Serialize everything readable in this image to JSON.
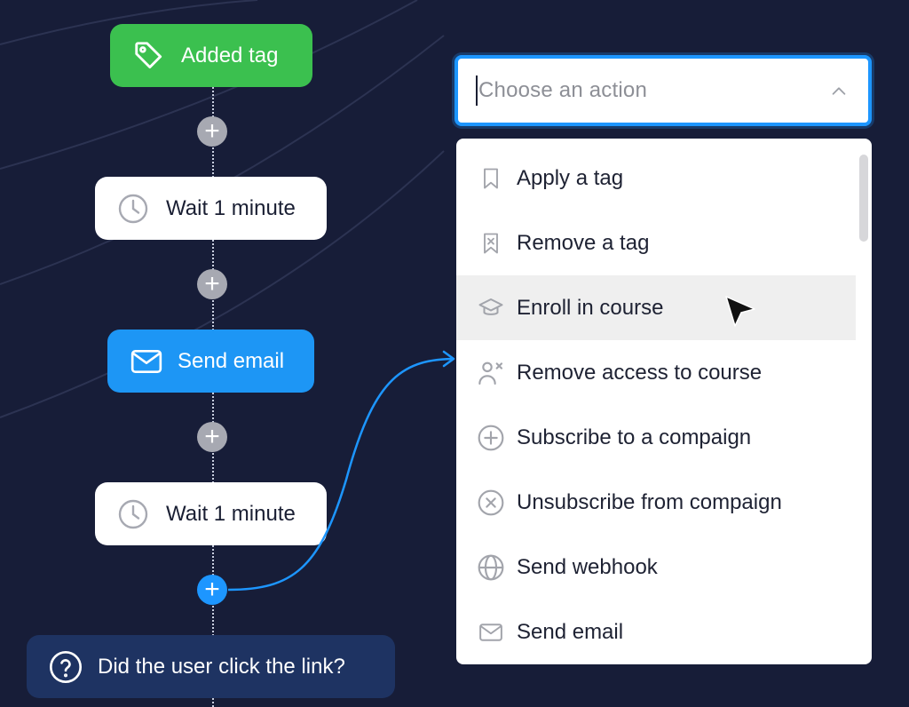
{
  "flow": {
    "trigger": {
      "label": "Added tag",
      "icon": "tag-icon"
    },
    "step1": {
      "label": "Wait 1 minute",
      "icon": "clock-icon"
    },
    "step2": {
      "label": "Send email",
      "icon": "mail-icon"
    },
    "step3": {
      "label": "Wait 1 minute",
      "icon": "clock-icon"
    },
    "condition": {
      "label": "Did the user click the link?",
      "icon": "question-circle-icon"
    },
    "add_symbol": "+"
  },
  "action_select": {
    "placeholder": "Choose an action",
    "chevron": "chevron-up-icon"
  },
  "menu": {
    "items": [
      {
        "label": "Apply a tag",
        "icon": "bookmark-icon"
      },
      {
        "label": "Remove a tag",
        "icon": "bookmark-x-icon"
      },
      {
        "label": "Enroll in course",
        "icon": "graduation-cap-icon",
        "hovered": true
      },
      {
        "label": "Remove access to course",
        "icon": "user-x-icon"
      },
      {
        "label": "Subscribe to a compaign",
        "icon": "plus-circle-icon"
      },
      {
        "label": "Unsubscribe from compaign",
        "icon": "x-circle-icon"
      },
      {
        "label": "Send webhook",
        "icon": "globe-icon"
      },
      {
        "label": "Send email",
        "icon": "mail-icon"
      }
    ]
  },
  "colors": {
    "background": "#171d38",
    "green": "#3bc04f",
    "blue": "#1d96f5",
    "navy": "#1e3362",
    "hover": "#efefef"
  }
}
